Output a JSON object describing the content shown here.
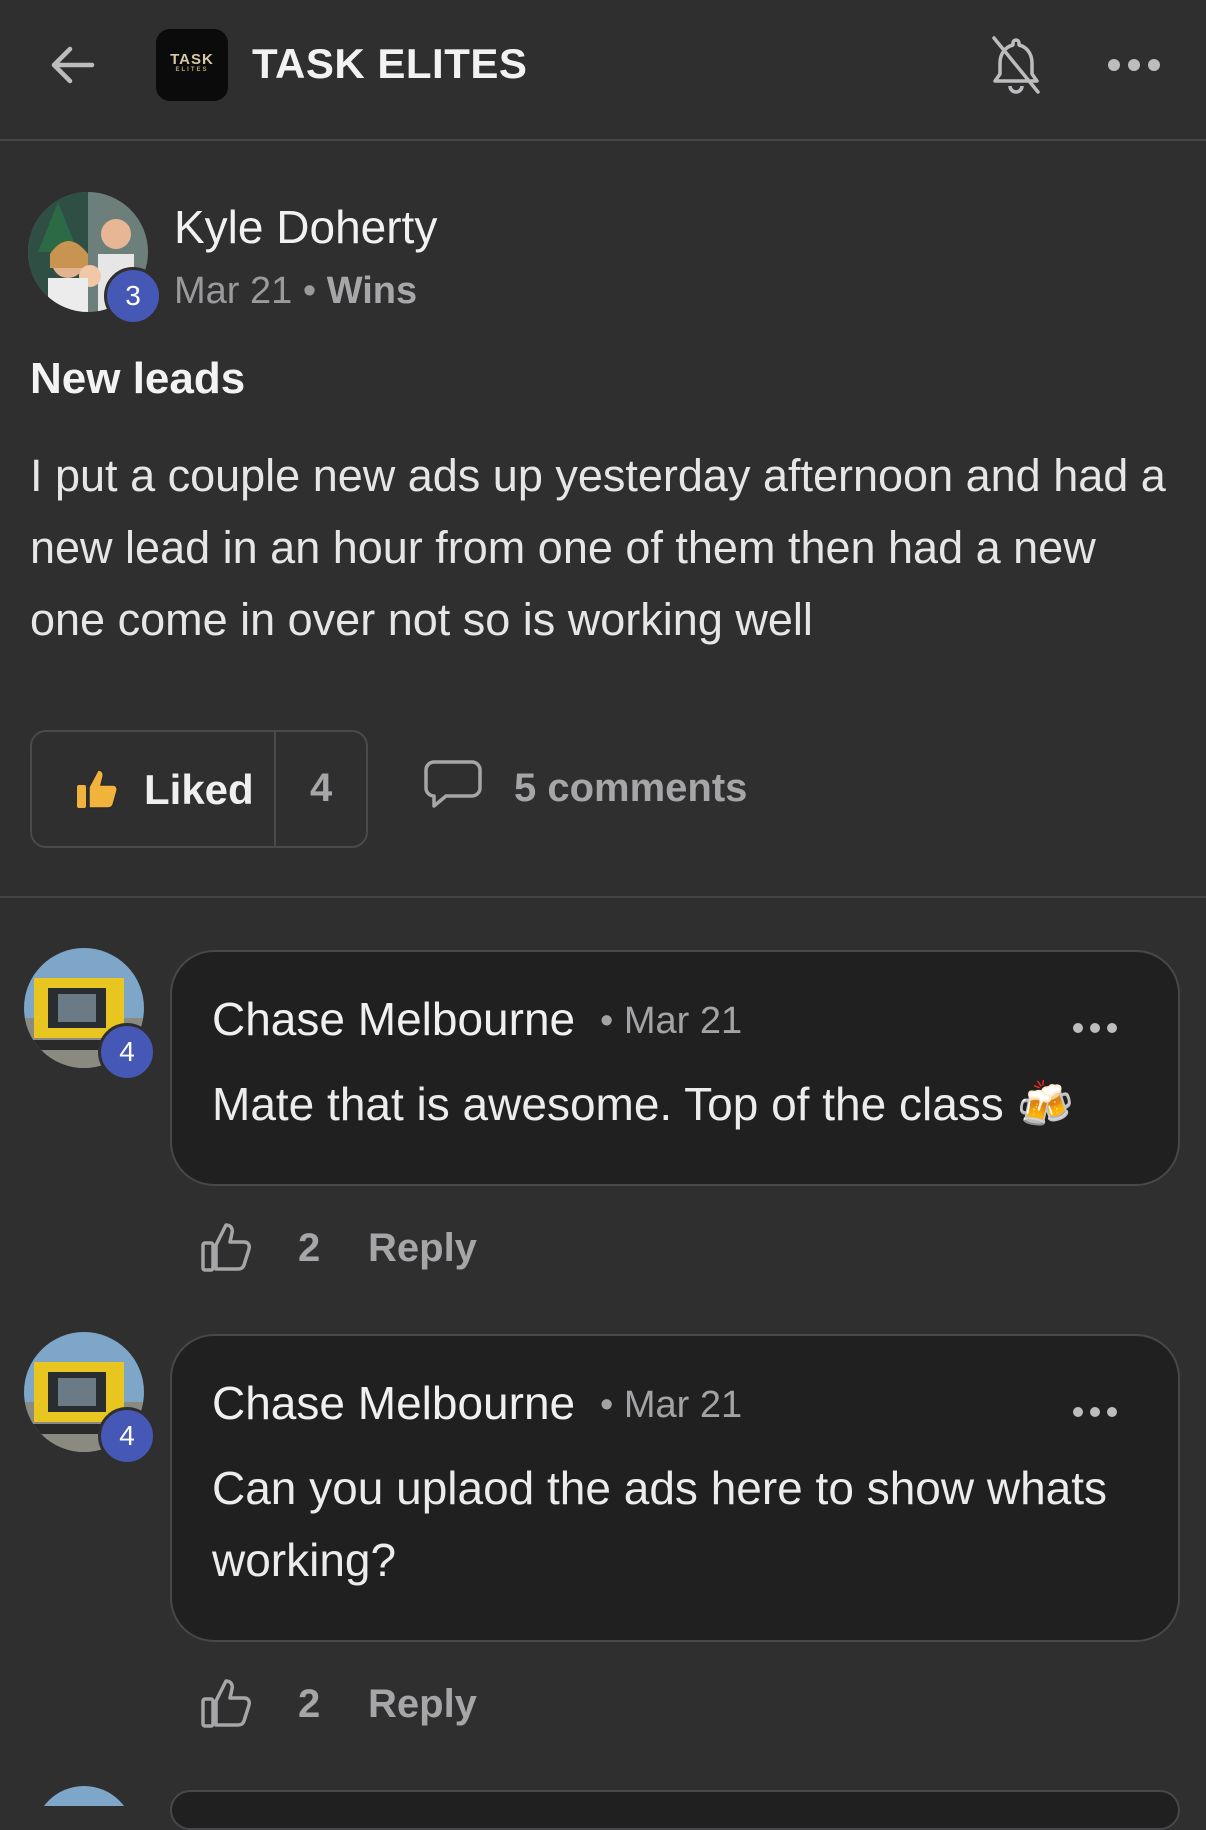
{
  "header": {
    "group_name": "TASK ELITES",
    "logo_line1": "TASK",
    "logo_line2": "ELITES",
    "icons": [
      "back-arrow-icon",
      "group-logo",
      "bell-off-icon",
      "more-options-icon"
    ]
  },
  "post": {
    "author": "Kyle Doherty",
    "author_level": "3",
    "date": "Mar 21",
    "separator": "•",
    "category": "Wins",
    "title": "New leads",
    "body": "I put a couple new ads up yesterday afternoon and had a new lead in an hour from one of them then had a new one come in over not so is working well",
    "liked_label": "Liked",
    "like_count": "4",
    "comments_label": "5 comments"
  },
  "comments": [
    {
      "author": "Chase Melbourne",
      "level": "4",
      "date": "Mar 21",
      "separator": "•",
      "text": "Mate that is awesome. Top of the class 🍻",
      "like_count": "2",
      "reply_label": "Reply"
    },
    {
      "author": "Chase Melbourne",
      "level": "4",
      "date": "Mar 21",
      "separator": "•",
      "text": "Can you uplaod the ads here to show whats working?",
      "like_count": "2",
      "reply_label": "Reply"
    }
  ],
  "colors": {
    "background": "#2f2f30",
    "bubble": "#202021",
    "badge": "#4658b5",
    "liked_icon": "#f2b33d"
  }
}
